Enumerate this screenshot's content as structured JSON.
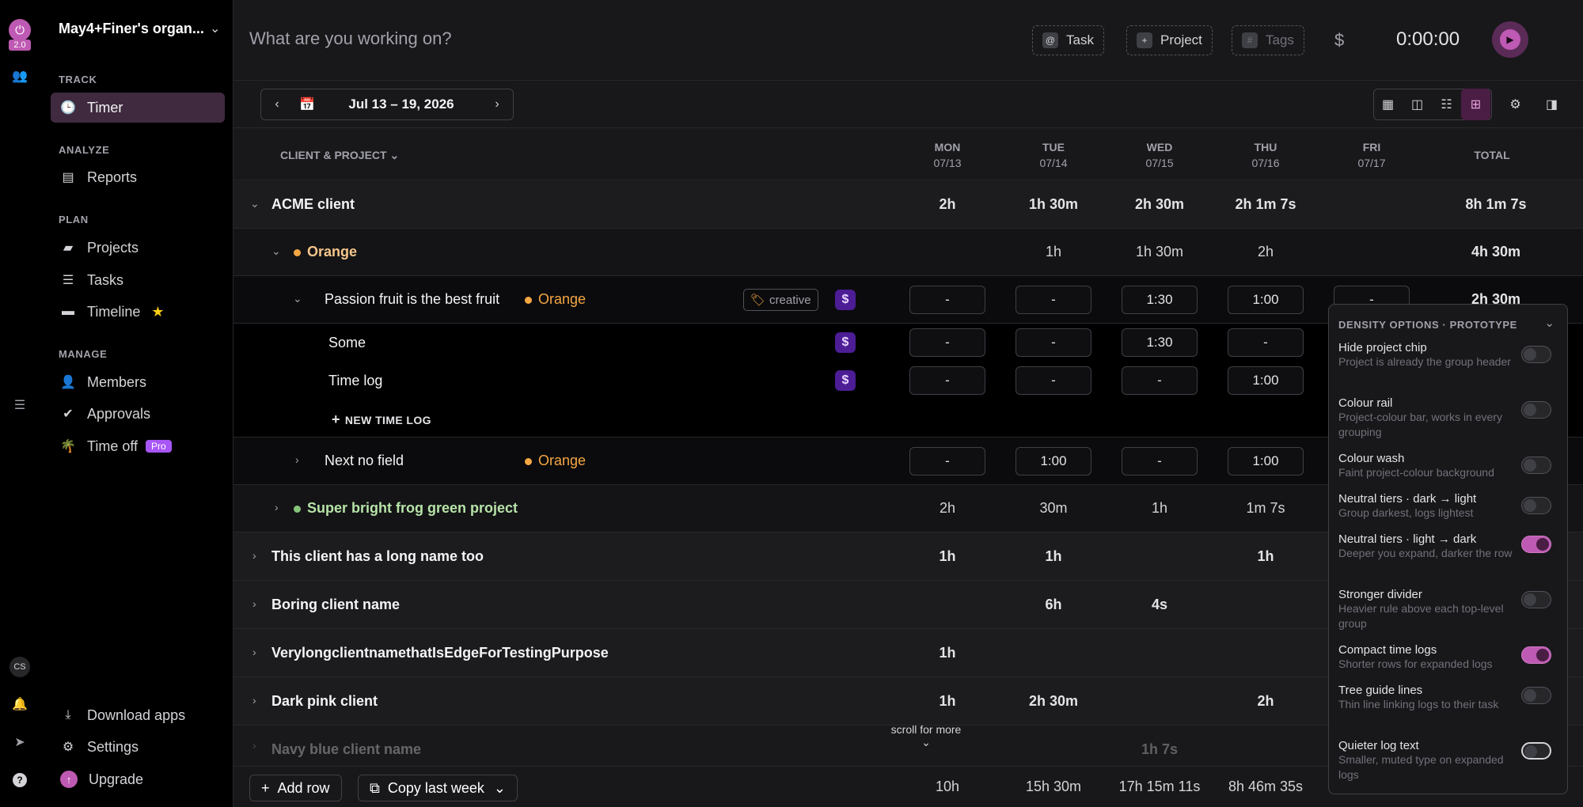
{
  "app": {
    "version_badge": "2.0",
    "org_name": "May4+Finer's organ...",
    "user_initials": "CS"
  },
  "sidebar": {
    "sections": {
      "track": "TRACK",
      "analyze": "ANALYZE",
      "plan": "PLAN",
      "manage": "MANAGE"
    },
    "items": {
      "timer": "Timer",
      "reports": "Reports",
      "projects": "Projects",
      "tasks": "Tasks",
      "timeline": "Timeline",
      "members": "Members",
      "approvals": "Approvals",
      "time_off": "Time off",
      "pro_badge": "Pro"
    },
    "bottom": {
      "download": "Download apps",
      "settings": "Settings",
      "upgrade": "Upgrade"
    }
  },
  "topbar": {
    "placeholder": "What are you working on?",
    "task_chip": "Task",
    "task_prefix": "@",
    "project_chip": "Project",
    "project_prefix": "+",
    "tags_chip": "Tags",
    "tags_prefix": "#",
    "billable_symbol": "$",
    "timer": "0:00:00"
  },
  "date_range": "Jul 13 – 19, 2026",
  "table": {
    "group_header": "CLIENT & PROJECT",
    "days": [
      {
        "dow": "MON",
        "date": "07/13"
      },
      {
        "dow": "TUE",
        "date": "07/14"
      },
      {
        "dow": "WED",
        "date": "07/15"
      },
      {
        "dow": "THU",
        "date": "07/16"
      },
      {
        "dow": "FRI",
        "date": "07/17"
      }
    ],
    "total_header": "TOTAL",
    "acme": {
      "name": "ACME client",
      "mon": "2h",
      "tue": "1h 30m",
      "wed": "2h 30m",
      "thu": "2h 1m 7s",
      "total": "8h 1m 7s"
    },
    "orange": {
      "name": "Orange",
      "tue": "1h",
      "wed": "1h 30m",
      "thu": "2h",
      "total": "4h 30m"
    },
    "passion": {
      "name": "Passion fruit is the best fruit",
      "project": "Orange",
      "tag": "creative",
      "mon": "-",
      "tue": "-",
      "wed": "1:30",
      "thu": "1:00",
      "fri": "-",
      "total": "2h 30m"
    },
    "some": {
      "name": "Some",
      "mon": "-",
      "tue": "-",
      "wed": "1:30",
      "thu": "-"
    },
    "timelog": {
      "name": "Time log",
      "mon": "-",
      "tue": "-",
      "wed": "-",
      "thu": "1:00"
    },
    "new_time_log": "NEW TIME LOG",
    "next": {
      "name": "Next no field",
      "project": "Orange",
      "mon": "-",
      "tue": "1:00",
      "wed": "-",
      "thu": "1:00"
    },
    "frog": {
      "name": "Super bright frog green project",
      "mon": "2h",
      "tue": "30m",
      "wed": "1h",
      "thu": "1m 7s"
    },
    "long": {
      "name": "This client has a long name too",
      "mon": "1h",
      "tue": "1h",
      "thu": "1h"
    },
    "boring": {
      "name": "Boring client name",
      "tue": "6h",
      "wed": "4s"
    },
    "verylong": {
      "name": "VerylongclientnamethatIsEdgeForTestingPurpose",
      "mon": "1h"
    },
    "darkpink": {
      "name": "Dark pink client",
      "mon": "1h",
      "tue": "2h 30m",
      "thu": "2h"
    },
    "navy": {
      "name": "Navy blue client name",
      "wed": "1h 7s"
    },
    "scroll_hint": "scroll for more",
    "totals": {
      "mon": "10h",
      "tue": "15h 30m",
      "wed": "17h 15m 11s",
      "thu": "8h 46m 35s"
    }
  },
  "footer": {
    "add_row": "Add row",
    "copy_last_week": "Copy last week"
  },
  "panel": {
    "title": "DENSITY OPTIONS · PROTOTYPE",
    "options": [
      {
        "title": "Hide project chip",
        "desc": "Project is already the group header",
        "on": false
      },
      {
        "title": "Colour rail",
        "desc": "Project-colour bar, works in every grouping",
        "on": false
      },
      {
        "title": "Colour wash",
        "desc": "Faint project-colour background",
        "on": false
      },
      {
        "title": "Neutral tiers · dark → light",
        "desc": "Group darkest, logs lightest",
        "on": false
      },
      {
        "title": "Neutral tiers · light → dark",
        "desc": "Deeper you expand, darker the row",
        "on": true
      },
      {
        "title": "Stronger divider",
        "desc": "Heavier rule above each top-level group",
        "on": false
      },
      {
        "title": "Compact time logs",
        "desc": "Shorter rows for expanded logs",
        "on": true
      },
      {
        "title": "Tree guide lines",
        "desc": "Thin line linking logs to their task",
        "on": false
      },
      {
        "title": "Quieter log text",
        "desc": "Smaller, muted type on expanded logs",
        "on": false
      }
    ]
  },
  "colors": {
    "accent": "#be5ab3",
    "orange": "#f5a742",
    "green": "#86c57a"
  }
}
